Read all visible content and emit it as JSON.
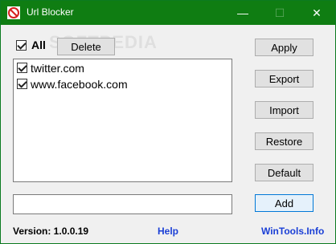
{
  "window": {
    "title": "Url Blocker",
    "titlebar_color": "#0f7d12",
    "controls": {
      "minimize": "—",
      "maximize": "☐",
      "close": "✕"
    }
  },
  "toolbar": {
    "all_label": "All",
    "all_checked": true,
    "delete_label": "Delete"
  },
  "watermark": "SOFTPEDIA",
  "url_list": {
    "items": [
      {
        "label": "twitter.com",
        "checked": true
      },
      {
        "label": "www.facebook.com",
        "checked": true
      }
    ]
  },
  "side_buttons": {
    "apply": "Apply",
    "export": "Export",
    "import": "Import",
    "restore": "Restore",
    "default": "Default",
    "add": "Add"
  },
  "input": {
    "value": "",
    "placeholder": ""
  },
  "footer": {
    "version": "Version: 1.0.0.19",
    "help": "Help",
    "site": "WinTools.Info",
    "link_color": "#1a3fd6"
  }
}
